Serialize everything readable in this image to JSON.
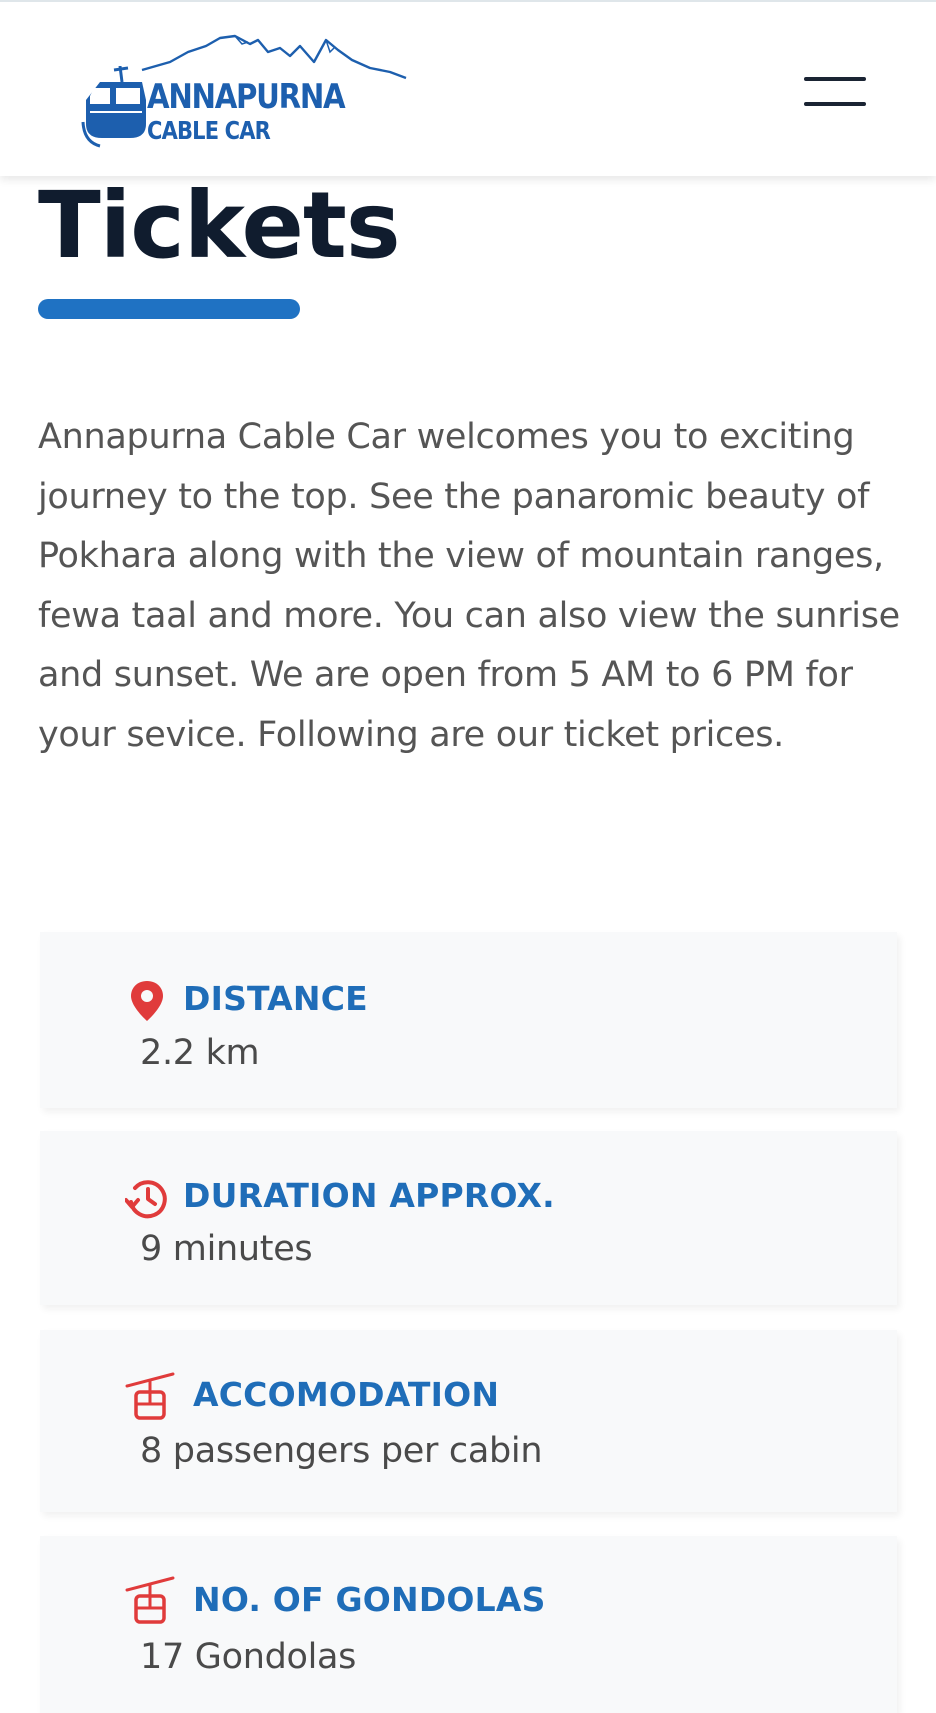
{
  "header": {
    "logo": {
      "title": "ANNAPURNA",
      "subtitle": "CABLE CAR"
    },
    "menu_icon": "hamburger-menu-icon"
  },
  "page": {
    "title": "Tickets",
    "intro": "Annapurna Cable Car welcomes you to exciting journey to the top. See the panaromic beauty of Pokhara along with the view of mountain ranges, fewa taal and more. You can also view the sunrise and sunset. We are open from 5 AM to 6 PM for your sevice. Following are our ticket prices."
  },
  "info_cards": [
    {
      "icon": "location-pin-icon",
      "label": "DISTANCE",
      "value": "2.2 km"
    },
    {
      "icon": "history-clock-icon",
      "label": "DURATION APPROX.",
      "value": "9 minutes"
    },
    {
      "icon": "cable-car-icon",
      "label": "ACCOMODATION",
      "value": "8 passengers per cabin"
    },
    {
      "icon": "cable-car-icon",
      "label": "NO. OF GONDOLAS",
      "value": "17 Gondolas"
    }
  ],
  "colors": {
    "brand_blue": "#1d5fae",
    "accent_blue": "#1f72c3",
    "label_blue": "#1f6db8",
    "icon_red": "#e03b3b",
    "title_dark": "#101c2e",
    "body_text": "#555555",
    "card_bg": "#f8f9fa"
  }
}
